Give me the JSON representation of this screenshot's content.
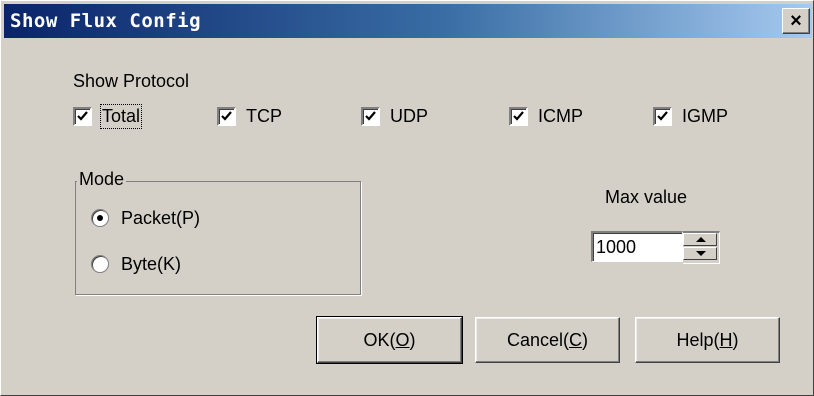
{
  "window": {
    "title": "Show Flux Config",
    "close_symbol": "×"
  },
  "protocol": {
    "label": "Show Protocol",
    "options": [
      {
        "label": "Total",
        "checked": true
      },
      {
        "label": "TCP",
        "checked": true
      },
      {
        "label": "UDP",
        "checked": true
      },
      {
        "label": "ICMP",
        "checked": true
      },
      {
        "label": "IGMP",
        "checked": true
      }
    ]
  },
  "mode": {
    "label": "Mode",
    "options": [
      {
        "label": "Packet(P)",
        "selected": true
      },
      {
        "label": "Byte(K)",
        "selected": false
      }
    ]
  },
  "max_value": {
    "label": "Max value",
    "value": "1000"
  },
  "buttons": {
    "ok": {
      "prefix": "OK(",
      "accel": "O",
      "suffix": ")"
    },
    "cancel": {
      "prefix": "Cancel(",
      "accel": "C",
      "suffix": ")"
    },
    "help": {
      "prefix": "Help(",
      "accel": "H",
      "suffix": ")"
    }
  },
  "icons": {
    "checkbox_mark": "check-icon",
    "spin_up": "arrow-up-icon",
    "spin_down": "arrow-down-icon"
  }
}
